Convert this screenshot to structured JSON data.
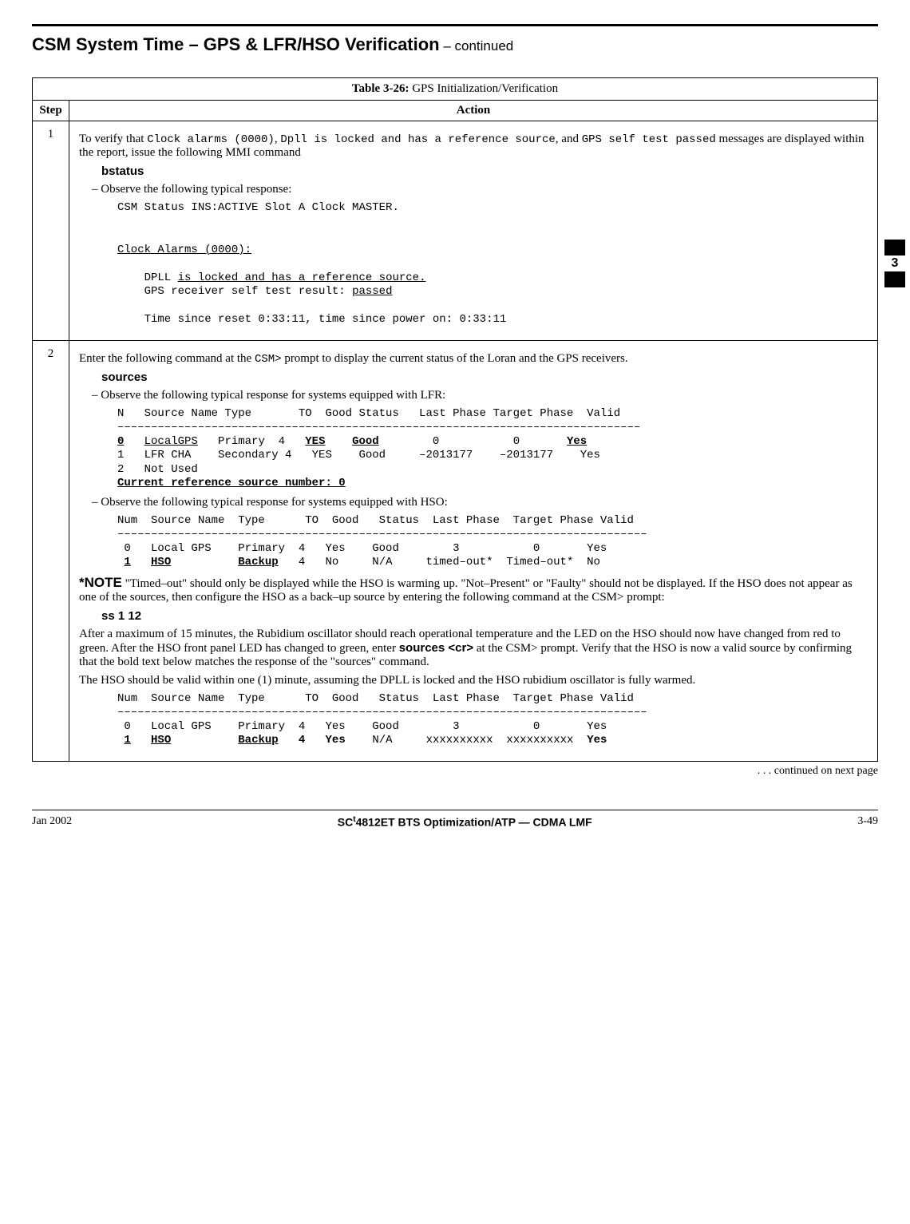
{
  "header": {
    "title_main": "CSM System Time – GPS & LFR/HSO Verification",
    "title_cont": " – continued"
  },
  "sidetab": {
    "label": "3"
  },
  "table": {
    "caption_bold": "Table 3-26:",
    "caption_rest": " GPS Initialization/Verification",
    "col_step": "Step",
    "col_action": "Action"
  },
  "step1": {
    "num": "1",
    "intro_pre": "To verify that ",
    "code1": "Clock alarms (0000)",
    "mid1": ", ",
    "code2": "Dpll is locked and has a reference source",
    "mid2": ", and ",
    "code3": "GPS self test passed",
    "intro_post": " messages are displayed within the report,  issue the following MMI command",
    "cmd": "bstatus",
    "observe": "Observe the following typical response:",
    "resp_line1": "CSM Status INS:ACTIVE Slot A Clock MASTER.",
    "resp_line2_u": "Clock Alarms (0000):",
    "resp_line3a": "    DPLL ",
    "resp_line3b_u": "is locked and has a reference source.",
    "resp_line4a": "    GPS receiver self test result: ",
    "resp_line4b_u": "passed",
    "resp_line5": "    Time since reset 0:33:11, time since power on: 0:33:11"
  },
  "step2": {
    "num": "2",
    "intro_pre": "Enter the following command at the ",
    "code_prompt": "CSM>",
    "intro_post": " prompt to display the current status of the Loran and the GPS receivers.",
    "cmd": "sources",
    "observe_lfr": "Observe the following typical response for systems equipped with LFR:",
    "lfr_header": "N   Source Name Type       TO  Good Status   Last Phase Target Phase  Valid",
    "lfr_divider": "––––––––––––––––––––––––––––––––––––––––––––––––––––––––––––––––––––––––––––––",
    "lfr_r0_num": "0",
    "lfr_r0_name": "LocalGPS",
    "lfr_r0_type": "   Primary  4   ",
    "lfr_r0_to": "YES",
    "lfr_r0_good": "Good",
    "lfr_r0_rest": "        0           0       ",
    "lfr_r0_valid": "Yes",
    "lfr_r1": "1   LFR CHA    Secondary 4   YES    Good     –2013177    –2013177    Yes",
    "lfr_r2": "2   Not Used",
    "lfr_current": "Current reference source number: 0",
    "observe_hso": "Observe the following typical response for systems equipped with HSO:",
    "hso_header": "Num  Source Name  Type      TO  Good   Status  Last Phase  Target Phase Valid",
    "hso_divider": "–––––––––––––––––––––––––––––––––––––––––––––––––––––––––––––––––––––––––––––––",
    "hso_r0": " 0   Local GPS    Primary  4   Yes    Good        3           0       Yes",
    "hso_r1_num": "1",
    "hso_r1_name": "HSO",
    "hso_r1_type_gap": "          ",
    "hso_r1_type": "Backup",
    "hso_r1_rest": "   4   No     N/A     timed–out*  Timed–out*  No",
    "note_bold": "*NOTE",
    "note_text": " \"Timed–out\" should only be displayed while the HSO is warming up.  \"Not–Present\" or \"Faulty\" should not be displayed.  If the HSO does not appear as one of the sources, then configure the HSO as a back–up source by entering the following command at the CSM> prompt:",
    "cmd2": "ss 1 12",
    "para2_pre": "After a maximum of 15 minutes, the Rubidium oscillator should reach operational temperature and the LED on the HSO should now have changed from red to green.  After the HSO front panel LED has changed to green, enter ",
    "para2_bold": "sources <cr>",
    "para2_post": " at the CSM> prompt.  Verify that the HSO is now a valid source by confirming that the bold text below matches the response of the \"sources\" command.",
    "para3": "The HSO should be valid within one (1) minute, assuming the DPLL is locked and the HSO rubidium oscillator is fully warmed.",
    "final_header": "Num  Source Name  Type      TO  Good   Status  Last Phase  Target Phase Valid",
    "final_divider": "–––––––––––––––––––––––––––––––––––––––––––––––––––––––––––––––––––––––––––––––",
    "final_r0": " 0   Local GPS    Primary  4   Yes    Good        3           0       Yes",
    "final_r1_num": "1",
    "final_r1_name": "HSO",
    "final_r1_type_gap": "          ",
    "final_r1_type": "Backup",
    "final_r1_mid1": "   ",
    "final_r1_to": "4",
    "final_r1_mid2": "   ",
    "final_r1_good": "Yes",
    "final_r1_mid3": "    N/A     xxxxxxxxxx  xxxxxxxxxx  ",
    "final_r1_valid": "Yes"
  },
  "continued": ". . . continued on next page",
  "footer": {
    "left": "Jan 2002",
    "center_pre": "SC",
    "center_tm": "t",
    "center_post": "4812ET BTS Optimization/ATP — CDMA LMF",
    "right": "3-49"
  }
}
